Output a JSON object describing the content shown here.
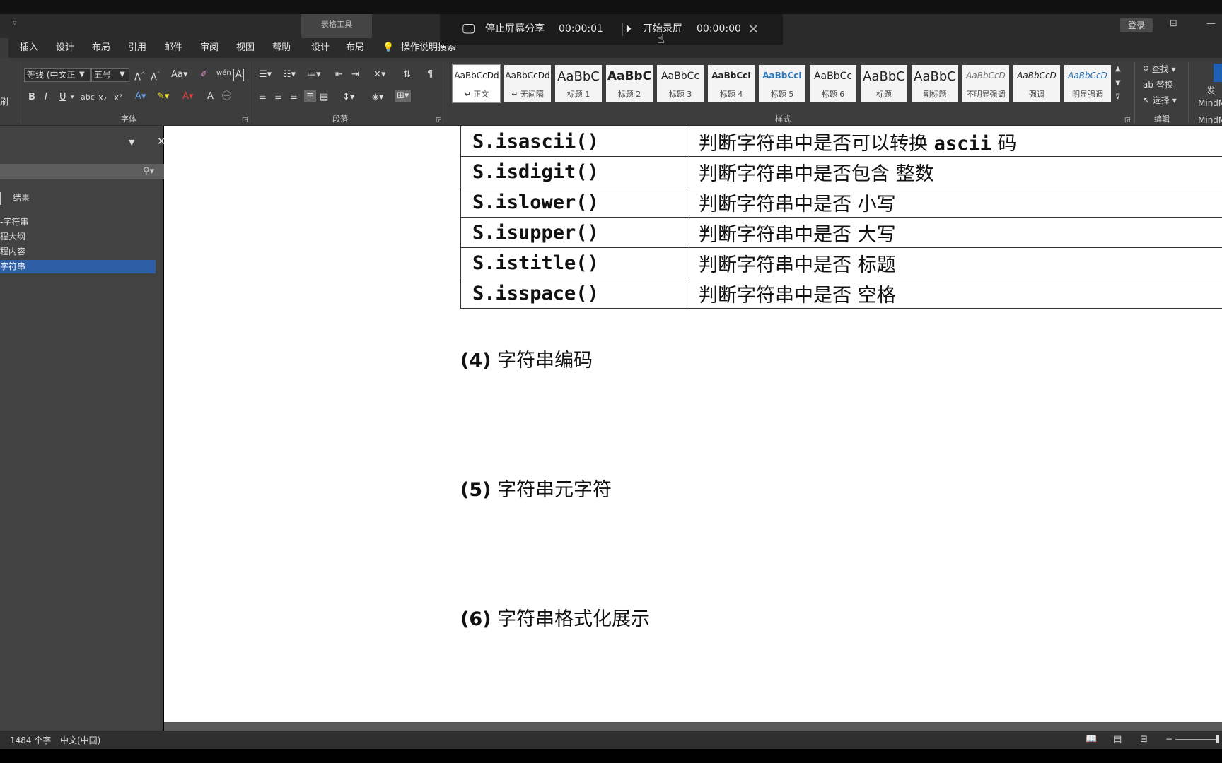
{
  "window": {
    "context_group_title": "表格工具",
    "login_label": "登录"
  },
  "share_bar": {
    "stop_share_label": "停止屏幕分享",
    "share_timer": "00:00:01",
    "start_record_label": "开始录屏",
    "record_timer": "00:00:00"
  },
  "tabs": [
    "插入",
    "设计",
    "布局",
    "引用",
    "邮件",
    "审阅",
    "视图",
    "帮助",
    "设计",
    "布局"
  ],
  "tell_me": "操作说明搜索",
  "ribbon": {
    "font_name": "等线 (中文正",
    "font_size": "五号",
    "font_group_label": "字体",
    "paragraph_group_label": "段落",
    "styles_group_label": "样式",
    "edit_group_label": "编辑",
    "format_painter_label": "刷",
    "styles": [
      {
        "sample": "AaBbCcDd",
        "label": "↵ 正文"
      },
      {
        "sample": "AaBbCcDd",
        "label": "↵ 无间隔"
      },
      {
        "sample": "AaBbC",
        "label": "标题 1"
      },
      {
        "sample": "AaBbC",
        "label": "标题 2"
      },
      {
        "sample": "AaBbCc",
        "label": "标题 3"
      },
      {
        "sample": "AaBbCcI",
        "label": "标题 4"
      },
      {
        "sample": "AaBbCcI",
        "label": "标题 5"
      },
      {
        "sample": "AaBbCc",
        "label": "标题 6"
      },
      {
        "sample": "AaBbC",
        "label": "标题"
      },
      {
        "sample": "AaBbC",
        "label": "副标题"
      },
      {
        "sample": "AaBbCcD",
        "label": "不明显强调"
      },
      {
        "sample": "AaBbCcD",
        "label": "强调"
      },
      {
        "sample": "AaBbCcD",
        "label": "明显强调"
      }
    ],
    "find_label": "查找",
    "replace_label": "替换",
    "select_label": "选择",
    "addin_label_1": "发",
    "addin_label_2": "MindM",
    "addin_label_3": "MindM"
  },
  "nav_pane": {
    "results_tab": "结果",
    "items": [
      "-字符串",
      "程大纲",
      "程内容",
      "字符串"
    ]
  },
  "document": {
    "table_rows": [
      {
        "fn": "S.isascii()",
        "desc_pre": "判断字符串中是否可以转换 ",
        "desc_code": "ascii",
        "desc_post": " 码"
      },
      {
        "fn": "S.isdigit()",
        "desc_pre": "判断字符串中是否包含 整数",
        "desc_code": "",
        "desc_post": ""
      },
      {
        "fn": "S.islower()",
        "desc_pre": "判断字符串中是否 小写",
        "desc_code": "",
        "desc_post": ""
      },
      {
        "fn": "S.isupper()",
        "desc_pre": "判断字符串中是否 大写",
        "desc_code": "",
        "desc_post": ""
      },
      {
        "fn": "S.istitle()",
        "desc_pre": "判断字符串中是否 标题",
        "desc_code": "",
        "desc_post": ""
      },
      {
        "fn": "S.isspace()",
        "desc_pre": "判断字符串中是否 空格",
        "desc_code": "",
        "desc_post": ""
      }
    ],
    "headings": [
      {
        "num": "(4)",
        "text": "字符串编码"
      },
      {
        "num": "(5)",
        "text": "字符串元字符"
      },
      {
        "num": "(6)",
        "text": "字符串格式化展示"
      }
    ]
  },
  "status": {
    "word_count": "1484 个字",
    "language": "中文(中国)"
  }
}
